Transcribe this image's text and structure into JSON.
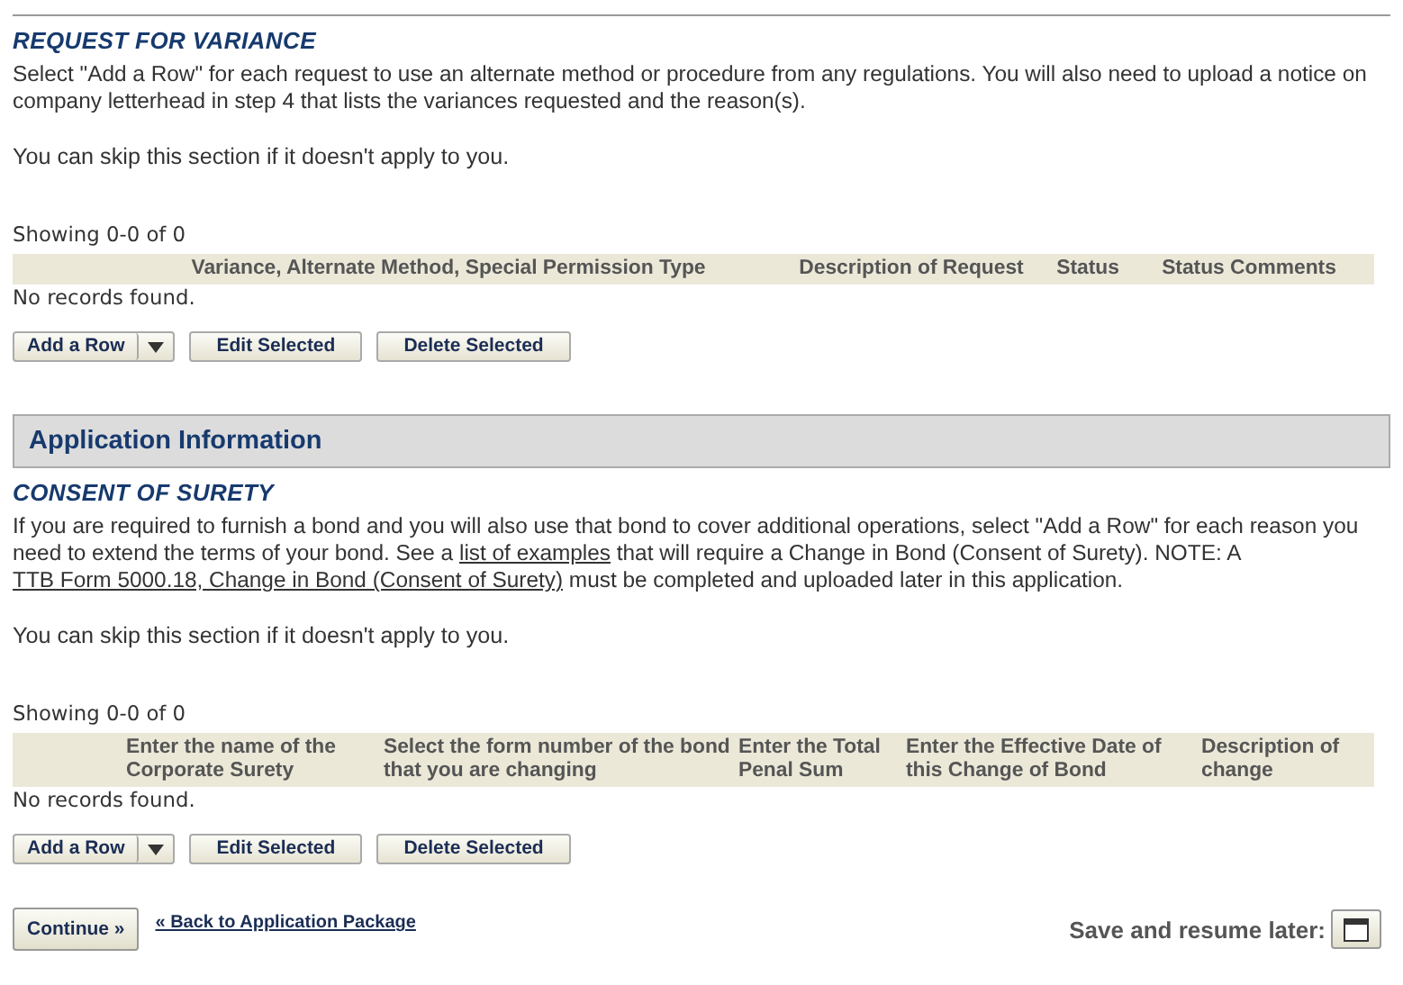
{
  "sections": [
    {
      "kind": "subsection",
      "title": "REQUEST FOR VARIANCE",
      "paragraphs": [
        [
          {
            "kind": "text",
            "text": "Select \"Add a Row\" for each request to use an alternate method or procedure from any regulations. You will also need to upload a notice on company letterhead in step 4 that lists the variances requested and the reason(s)."
          }
        ]
      ],
      "skip_note": "You can skip this section if it doesn't apply to you.",
      "showing": "Showing 0-0 of 0",
      "columns": [
        "Variance, Alternate Method, Special Permission Type",
        "Description of Request",
        "Status",
        "Status Comments"
      ],
      "empty_message": "No records found.",
      "buttons": [
        "Add a Row",
        "Edit Selected",
        "Delete Selected"
      ]
    },
    {
      "kind": "panel_header",
      "title": "Application Information"
    },
    {
      "kind": "subsection",
      "title": "CONSENT OF SURETY",
      "paragraphs": [
        [
          {
            "kind": "text",
            "text": "If you are required to furnish a bond and you will also use that bond to cover additional operations, select \"Add a Row\" for each reason you need to extend the terms of your bond. See a "
          },
          {
            "kind": "link",
            "text": "list of examples"
          },
          {
            "kind": "text",
            "text": " that will require a Change in Bond (Consent of Surety). NOTE: A "
          },
          {
            "kind": "link",
            "text": "TTB Form 5000.18, Change in Bond (Consent of Surety)"
          },
          {
            "kind": "text",
            "text": " must be completed and uploaded later in this application."
          }
        ]
      ],
      "skip_note": "You can skip this section if it doesn't apply to you.",
      "showing": "Showing 0-0 of 0",
      "columns": [
        "Enter the name of the Corporate Surety",
        "Select the form number of the bond that you are changing",
        "Enter the Total Penal Sum",
        "Enter the Effective Date of this Change of Bond",
        "Description of change"
      ],
      "empty_message": "No records found.",
      "buttons": [
        "Add a Row",
        "Edit Selected",
        "Delete Selected"
      ]
    }
  ],
  "footer": {
    "continue": "Continue »",
    "back_link": "« Back to Application Package",
    "save_label": "Save and resume later:"
  }
}
